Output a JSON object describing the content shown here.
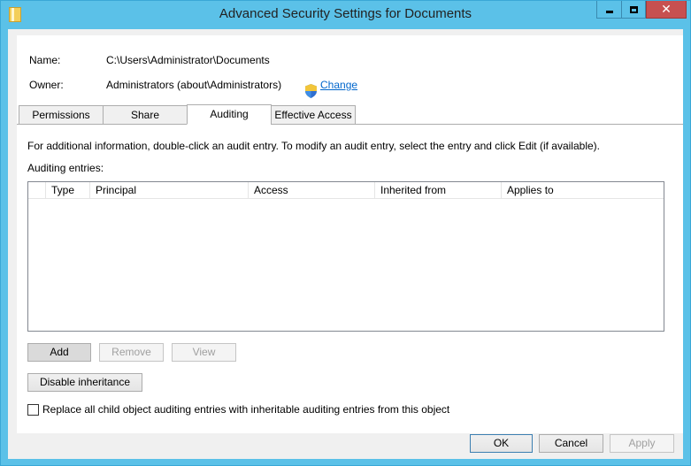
{
  "window": {
    "title": "Advanced Security Settings for Documents"
  },
  "titlebar_buttons": {
    "minimize": "minimize-icon",
    "maximize": "maximize-icon",
    "close": "close-icon"
  },
  "info": {
    "name_label": "Name:",
    "name_value": "C:\\Users\\Administrator\\Documents",
    "owner_label": "Owner:",
    "owner_value": "Administrators (about\\Administrators)",
    "change_link": "Change"
  },
  "tabs": [
    {
      "label": "Permissions",
      "active": false
    },
    {
      "label": "Share",
      "active": false
    },
    {
      "label": "Auditing",
      "active": true
    },
    {
      "label": "Effective Access",
      "active": false
    }
  ],
  "auditing": {
    "instructions": "For additional information, double-click an audit entry. To modify an audit entry, select the entry and click Edit (if available).",
    "entries_label": "Auditing entries:",
    "columns": [
      "Type",
      "Principal",
      "Access",
      "Inherited from",
      "Applies to"
    ],
    "rows": [],
    "add_button": "Add",
    "remove_button": "Remove",
    "view_button": "View",
    "disable_inheritance_button": "Disable inheritance",
    "replace_checkbox_label": "Replace all child object auditing entries with inheritable auditing entries from this object",
    "replace_checked": false
  },
  "footer": {
    "ok": "OK",
    "cancel": "Cancel",
    "apply": "Apply"
  },
  "colors": {
    "titlebar": "#5bc1e8",
    "close_button": "#c75050",
    "link": "#0066cc"
  }
}
